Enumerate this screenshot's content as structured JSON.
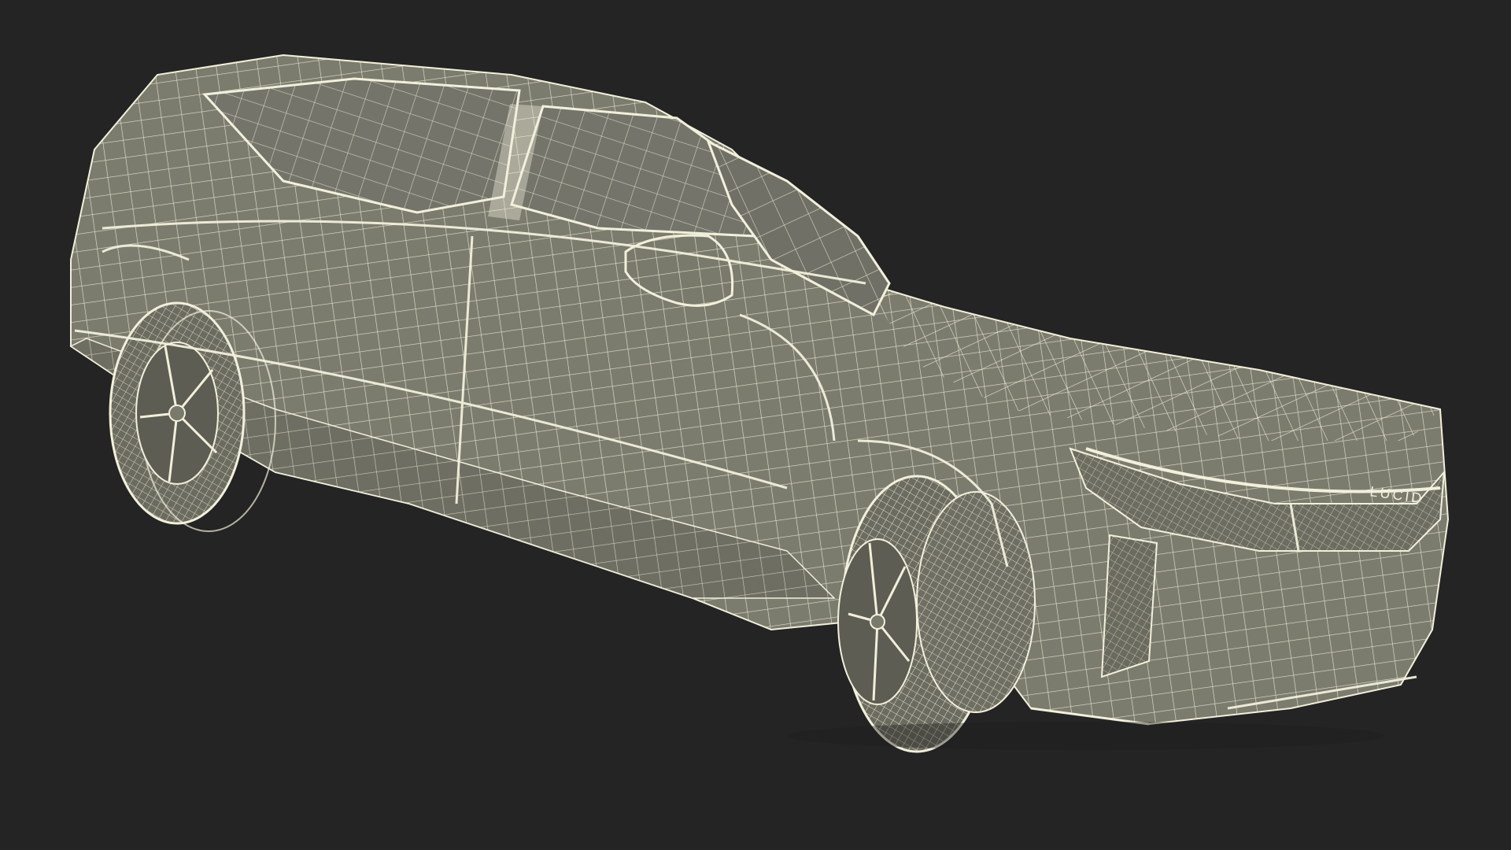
{
  "scene": {
    "subject": "car-wireframe-render",
    "background_color": "#242424",
    "body_fill": "#7a7a6c",
    "body_fill_dark": "#5f5f55",
    "wire_color": "#f2f0dc",
    "shadow_color": "#3a3a36"
  },
  "badge": {
    "text": "LUCID"
  }
}
